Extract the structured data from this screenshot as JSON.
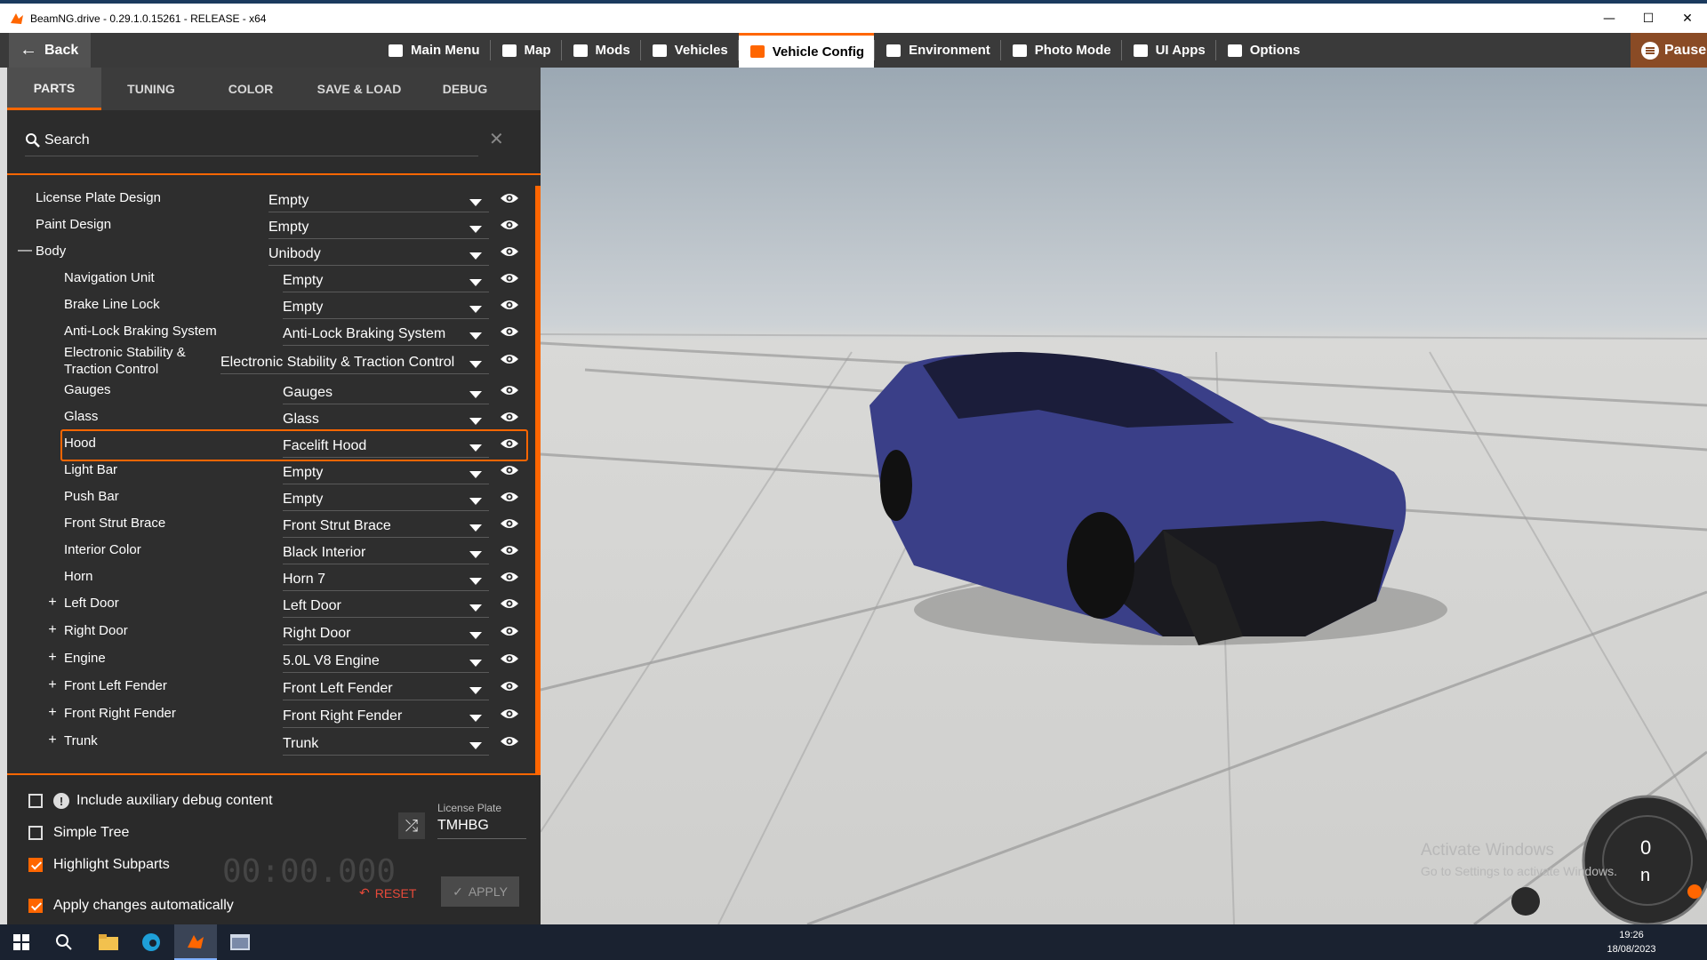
{
  "window": {
    "title": "BeamNG.drive - 0.29.1.0.15261 - RELEASE - x64",
    "minimize": "—",
    "maximize": "☐",
    "close": "✕"
  },
  "menubar": {
    "back_label": "Back",
    "items": [
      {
        "label": "Main Menu",
        "icon": "grid-icon"
      },
      {
        "label": "Map",
        "icon": "map-icon"
      },
      {
        "label": "Mods",
        "icon": "puzzle-icon"
      },
      {
        "label": "Vehicles",
        "icon": "car-icon"
      },
      {
        "label": "Vehicle Config",
        "icon": "engine-icon",
        "active": true
      },
      {
        "label": "Environment",
        "icon": "weather-icon"
      },
      {
        "label": "Photo Mode",
        "icon": "camera-icon"
      },
      {
        "label": "UI Apps",
        "icon": "apps-icon"
      },
      {
        "label": "Options",
        "icon": "sliders-icon"
      }
    ],
    "pause_label": "Pause"
  },
  "tabs": [
    "PARTS",
    "TUNING",
    "COLOR",
    "SAVE & LOAD",
    "DEBUG"
  ],
  "search": {
    "placeholder": "Search"
  },
  "parts": [
    {
      "label": "License Plate Design",
      "value": "Empty",
      "level": 0,
      "expander": ""
    },
    {
      "label": "Paint Design",
      "value": "Empty",
      "level": 0,
      "expander": ""
    },
    {
      "label": "Body",
      "value": "Unibody",
      "level": 0,
      "expander": "—"
    },
    {
      "label": "Navigation Unit",
      "value": "Empty",
      "level": 1,
      "expander": ""
    },
    {
      "label": "Brake Line Lock",
      "value": "Empty",
      "level": 1,
      "expander": ""
    },
    {
      "label": "Anti-Lock Braking System",
      "value": "Anti-Lock Braking System",
      "level": 1,
      "expander": ""
    },
    {
      "label": "Electronic Stability & Traction Control",
      "value": "Electronic Stability & Traction Control",
      "level": 1,
      "expander": ""
    },
    {
      "label": "Gauges",
      "value": "Gauges",
      "level": 1,
      "expander": ""
    },
    {
      "label": "Glass",
      "value": "Glass",
      "level": 1,
      "expander": ""
    },
    {
      "label": "Hood",
      "value": "Facelift Hood",
      "level": 1,
      "expander": "",
      "highlight": true
    },
    {
      "label": "Light Bar",
      "value": "Empty",
      "level": 1,
      "expander": ""
    },
    {
      "label": "Push Bar",
      "value": "Empty",
      "level": 1,
      "expander": ""
    },
    {
      "label": "Front Strut Brace",
      "value": "Front Strut Brace",
      "level": 1,
      "expander": ""
    },
    {
      "label": "Interior Color",
      "value": "Black Interior",
      "level": 1,
      "expander": ""
    },
    {
      "label": "Horn",
      "value": "Horn 7",
      "level": 1,
      "expander": ""
    },
    {
      "label": "Left Door",
      "value": "Left Door",
      "level": 1,
      "expander": "+"
    },
    {
      "label": "Right Door",
      "value": "Right Door",
      "level": 1,
      "expander": "+"
    },
    {
      "label": "Engine",
      "value": "5.0L V8 Engine",
      "level": 1,
      "expander": "+"
    },
    {
      "label": "Front Left Fender",
      "value": "Front Left Fender",
      "level": 1,
      "expander": "+"
    },
    {
      "label": "Front Right Fender",
      "value": "Front Right Fender",
      "level": 1,
      "expander": "+"
    },
    {
      "label": "Trunk",
      "value": "Trunk",
      "level": 1,
      "expander": "+"
    }
  ],
  "options": {
    "aux_debug": {
      "label": "Include auxiliary debug content",
      "checked": false
    },
    "simple_tree": {
      "label": "Simple Tree",
      "checked": false
    },
    "highlight_subparts": {
      "label": "Highlight Subparts",
      "checked": true
    },
    "apply_auto": {
      "label": "Apply changes automatically",
      "checked": true
    }
  },
  "license_plate": {
    "label": "License Plate",
    "value": "TMHBG"
  },
  "buttons": {
    "reset": "RESET",
    "apply": "APPLY"
  },
  "ghost_timer": "00:00.000",
  "watermark": {
    "line1": "Activate Windows",
    "line2": "Go to Settings to activate Windows."
  },
  "taskbar": {
    "time": "19:26",
    "date": "18/08/2023"
  },
  "colors": {
    "accent": "#ff6600",
    "panel": "#2e2e2e",
    "car": "#3a3f88"
  }
}
